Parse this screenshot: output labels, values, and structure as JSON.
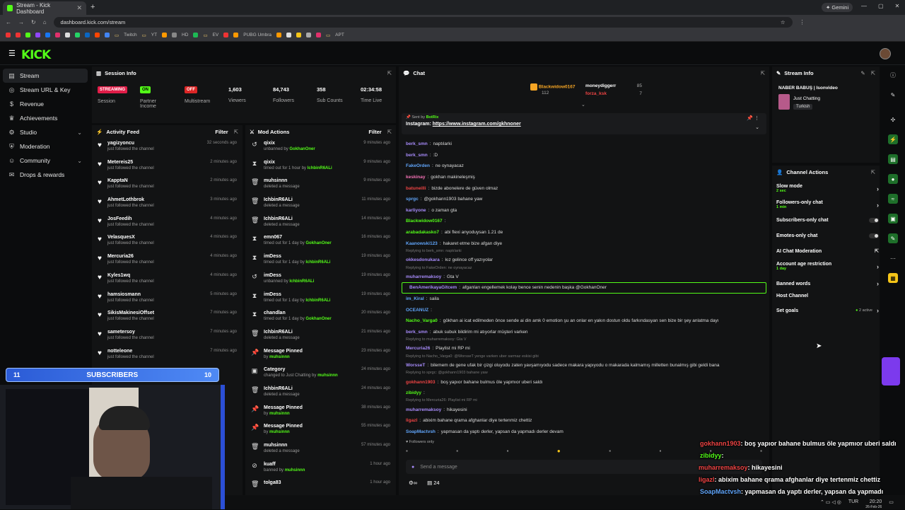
{
  "browser": {
    "tab_title": "Stream - Kick Dashboard",
    "url": "dashboard.kick.com/stream",
    "gemini_label": "Gemini",
    "bookmarks": [
      "Twitch",
      "YT",
      "HD",
      "EV",
      "PUBG Umbra",
      "APT"
    ]
  },
  "brand": {
    "logo": "KICK",
    "accent": "#53fc18"
  },
  "sidebar": {
    "items": [
      {
        "label": "Stream",
        "icon": "stream-icon"
      },
      {
        "label": "Stream URL & Key",
        "icon": "globe-icon"
      },
      {
        "label": "Revenue",
        "icon": "dollar-icon"
      },
      {
        "label": "Achievements",
        "icon": "trophy-icon"
      },
      {
        "label": "Studio",
        "icon": "studio-icon"
      },
      {
        "label": "Moderation",
        "icon": "shield-icon"
      },
      {
        "label": "Community",
        "icon": "community-icon"
      },
      {
        "label": "Drops & rewards",
        "icon": "gift-icon"
      }
    ]
  },
  "session": {
    "title": "Session Info",
    "status_badge": "STREAMING",
    "session_label": "Session",
    "partner_badge": "ON",
    "partner_label": "Partner Income",
    "multistream_badge": "OFF",
    "multistream_label": "Multistream",
    "viewers": "1,603",
    "viewers_label": "Viewers",
    "followers": "84,743",
    "followers_label": "Followers",
    "subs": "358",
    "subs_label": "Sub Counts",
    "time": "02:34:58",
    "time_label": "Time Live"
  },
  "activity": {
    "title": "Activity Feed",
    "filter": "Filter",
    "rows": [
      {
        "name": "yagizyoncu",
        "sub": "just followed the channel",
        "time": "32 seconds ago"
      },
      {
        "name": "Metereis25",
        "sub": "just followed the channel",
        "time": "2 minutes ago"
      },
      {
        "name": "KapptaN",
        "sub": "just followed the channel",
        "time": "2 minutes ago"
      },
      {
        "name": "AhmetLothbrok",
        "sub": "just followed the channel",
        "time": "3 minutes ago"
      },
      {
        "name": "JosFeedih",
        "sub": "just followed the channel",
        "time": "4 minutes ago"
      },
      {
        "name": "VelasquesX",
        "sub": "just followed the channel",
        "time": "4 minutes ago"
      },
      {
        "name": "Mercuria26",
        "sub": "just followed the channel",
        "time": "4 minutes ago"
      },
      {
        "name": "Kyles1wq",
        "sub": "just followed the channel",
        "time": "4 minutes ago"
      },
      {
        "name": "hamsiosmann",
        "sub": "just followed the channel",
        "time": "5 minutes ago"
      },
      {
        "name": "SikisMakinesiOffset",
        "sub": "just followed the channel",
        "time": "7 minutes ago"
      },
      {
        "name": "sametersoy",
        "sub": "just followed the channel",
        "time": "7 minutes ago"
      },
      {
        "name": "notteleone",
        "sub": "just followed the channel",
        "time": "7 minutes ago"
      }
    ]
  },
  "modactions": {
    "title": "Mod Actions",
    "filter": "Filter",
    "rows": [
      {
        "icon": "↺",
        "name": "qixix",
        "pre": "unbanned by ",
        "by": "GokhanOner",
        "time": "9 minutes ago"
      },
      {
        "icon": "⧗",
        "name": "qixix",
        "pre": "timed out for 1 hour by ",
        "by": "IchbinR6ALi",
        "time": "9 minutes ago"
      },
      {
        "icon": "🗑",
        "name": "muhsinnn",
        "pre": "deleted a message",
        "by": "",
        "time": "9 minutes ago"
      },
      {
        "icon": "🗑",
        "name": "IchbinR6ALi",
        "pre": "deleted a message",
        "by": "",
        "time": "11 minutes ago"
      },
      {
        "icon": "🗑",
        "name": "IchbinR6ALi",
        "pre": "deleted a message",
        "by": "",
        "time": "14 minutes ago"
      },
      {
        "icon": "⧗",
        "name": "emn067",
        "pre": "timed out for 1 day by ",
        "by": "GokhanOner",
        "time": "16 minutes ago"
      },
      {
        "icon": "⧗",
        "name": "imDess",
        "pre": "timed out for 1 day by ",
        "by": "IchbinR6ALi",
        "time": "19 minutes ago"
      },
      {
        "icon": "↺",
        "name": "imDess",
        "pre": "unbanned by ",
        "by": "IchbinR6ALi",
        "time": "19 minutes ago"
      },
      {
        "icon": "⧗",
        "name": "imDess",
        "pre": "timed out for 1 day by ",
        "by": "IchbinR6ALi",
        "time": "19 minutes ago"
      },
      {
        "icon": "⧗",
        "name": "chandlan",
        "pre": "timed out for 1 day by ",
        "by": "GokhanOner",
        "time": "20 minutes ago"
      },
      {
        "icon": "🗑",
        "name": "IchbinR6ALi",
        "pre": "deleted a message",
        "by": "",
        "time": "21 minutes ago"
      },
      {
        "icon": "📌",
        "name": "Message Pinned",
        "pre": "by ",
        "by": "muhsinnn",
        "time": "23 minutes ago"
      },
      {
        "icon": "▣",
        "name": "Category",
        "pre": "changed to Just Chatting by ",
        "by": "muhsinnn",
        "time": "24 minutes ago"
      },
      {
        "icon": "🗑",
        "name": "IchbinR6ALi",
        "pre": "deleted a message",
        "by": "",
        "time": "24 minutes ago"
      },
      {
        "icon": "📌",
        "name": "Message Pinned",
        "pre": "by ",
        "by": "muhsinnn",
        "time": "38 minutes ago"
      },
      {
        "icon": "📌",
        "name": "Message Pinned",
        "pre": "by ",
        "by": "muhsinnn",
        "time": "55 minutes ago"
      },
      {
        "icon": "🗑",
        "name": "muhsinnn",
        "pre": "deleted a message",
        "by": "",
        "time": "57 minutes ago"
      },
      {
        "icon": "⊘",
        "name": "kuaff",
        "pre": "banned by ",
        "by": "muhsinnn",
        "time": "1 hour ago"
      },
      {
        "icon": "🗑",
        "name": "tolga83",
        "pre": "",
        "by": "",
        "time": "1 hour ago"
      }
    ]
  },
  "chat": {
    "title": "Chat",
    "top_gifters": [
      {
        "name": "Blackwidow0167",
        "count": "112"
      },
      {
        "name": "moneydiggerr",
        "count": "85"
      },
      {
        "name": "forza_ksk",
        "count": "7"
      }
    ],
    "pinned": {
      "sent_by": "Sent by",
      "bot": "BotRix",
      "text": "Instagram: ",
      "link": "https://www.instagram.com/gkhnoner"
    },
    "messages": [
      {
        "user": "berk_smn",
        "color": "#a78bfa",
        "text": "naptılarki",
        "reply": ""
      },
      {
        "user": "berk_smn",
        "color": "#a78bfa",
        "text": ":D",
        "reply": ""
      },
      {
        "user": "FakeOrden",
        "color": "#60a5fa",
        "text": "ne oynayacaz",
        "reply": ""
      },
      {
        "user": "keskinay",
        "color": "#f472b6",
        "text": "gokhan makineleşmiş",
        "reply": ""
      },
      {
        "user": "batuneilli",
        "color": "#ef4444",
        "text": "bizde abonelere de güven olmaz",
        "reply": ""
      },
      {
        "user": "sprgc",
        "color": "#60a5fa",
        "text": "@gokhann1903 bahane yaw",
        "reply": ""
      },
      {
        "user": "karliyone",
        "color": "#a78bfa",
        "text": "o zaman gta",
        "reply": ""
      },
      {
        "user": "Blackwidow0167",
        "color": "#53fc18",
        "text": "",
        "reply": ""
      },
      {
        "user": "arabadakasko7",
        "color": "#53fc18",
        "text": "abi flexi anyoduysan 1.21 de",
        "reply": ""
      },
      {
        "user": "Kaanowski123",
        "color": "#60a5fa",
        "text": "hakaret etme bize afgan diye",
        "reply": ""
      },
      {
        "user": "okkesdonukara",
        "color": "#a78bfa",
        "text": "kız gelince off yazıyolar",
        "reply": "Replying to berk_smn: naptılarki"
      },
      {
        "user": "muharremaksoy",
        "color": "#a78bfa",
        "text": "Gta V",
        "reply": "Replying to FakeOrden: ne oynayacaz"
      },
      {
        "user": "BenAmerikayaGitcem",
        "color": "#a78bfa",
        "text": "afganları engellemek kolay bence senin nedenin başka @GokhanOner",
        "reply": "",
        "highlight": "true"
      },
      {
        "user": "im_Kiral",
        "color": "#60a5fa",
        "text": "saila",
        "reply": ""
      },
      {
        "user": "OCEANUZ",
        "color": "#60a5fa",
        "text": "",
        "reply": ""
      },
      {
        "user": "Nacho_Varga0",
        "color": "#53fc18",
        "text": "gökhan ai icat edilmeden önce sende ai din amk 0 emotion şu an onlar en yakın dostun oldu farkındasyan sen bize bir şey anlatma dayı",
        "reply": ""
      },
      {
        "user": "berk_smn",
        "color": "#a78bfa",
        "text": "abuk subuk bildirim mi atıyorlar müşteri varken",
        "reply": ""
      },
      {
        "user": "Mercuria26",
        "color": "#a78bfa",
        "text": "Playlist mi RP mi",
        "reply": "Replying to muharremaksoy: Gta V"
      },
      {
        "user": "WorsseT",
        "color": "#a78bfa",
        "text": "bilemem de gene ufak bir çizgi oluyodu zaten yavşamıyodu sadece makara yapıyodu o makarada kalmamış milletten bunalmış gibi geldi bana",
        "reply": "Replying to Nacho_Varga0: @WorsseT yenge varken uber sarmaz eskisi gibi"
      },
      {
        "user": "gokhann1903",
        "color": "#ef4444",
        "text": "boş yapıor bahane bulmus öle yapmıor uberi saldı",
        "reply": "Replying to sprgc: @gokhann1903 bahane yaw"
      },
      {
        "user": "zibidyy",
        "color": "#53fc18",
        "text": "",
        "reply": ""
      },
      {
        "user": "muharremaksoy",
        "color": "#a78bfa",
        "text": "hikayesini",
        "reply": "Replying to Mercuria26: Playlist mi RP mi"
      },
      {
        "user": "ligazl",
        "color": "#ef4444",
        "text": "abixim bahane qrama afghanlar diye tertenmiz chettiz",
        "reply": ""
      },
      {
        "user": "SoapMactvsh",
        "color": "#60a5fa",
        "text": "yapmasan da yaptı derler, yapsan da yapmadı derler devam",
        "reply": ""
      }
    ],
    "followers_only": "Followers only",
    "placeholder": "Send a message",
    "viewer_count": "24"
  },
  "stream_info": {
    "title": "Stream Info",
    "stream_title": "NABER BABUŞ | Isonvideo",
    "category": "Just Chatting",
    "language": "Turkish"
  },
  "channel_actions": {
    "title": "Channel Actions",
    "rows": [
      {
        "label": "Slow mode",
        "sub": "2 sec",
        "control": "arrow"
      },
      {
        "label": "Followers-only chat",
        "sub": "1 min",
        "control": "arrow"
      },
      {
        "label": "Subscribers-only chat",
        "sub": "",
        "control": "toggle"
      },
      {
        "label": "Emotes-only chat",
        "sub": "",
        "control": "toggle"
      },
      {
        "label": "AI Chat Moderation",
        "sub": "",
        "control": "external"
      },
      {
        "label": "Account age restriction",
        "sub": "1 day",
        "control": "arrow"
      },
      {
        "label": "Banned words",
        "sub": "",
        "control": "arrow"
      },
      {
        "label": "Host Channel",
        "sub": "",
        "control": "none"
      },
      {
        "label": "Set goals",
        "sub": "",
        "control": "arrow",
        "extra": "2 active"
      }
    ]
  },
  "overlay": {
    "subscribers_label": "SUBSCRIBERS",
    "left_count": "11",
    "right_count": "10",
    "messages": [
      {
        "user": "gokhann1903",
        "text": ": boş yapıor bahane bulmus öle yapmıor uberi saldı"
      },
      {
        "user": "zibidyy",
        "text": ":"
      },
      {
        "user": "muharremaksoy",
        "text": ": hikayesini"
      },
      {
        "user": "ligazl",
        "text": ": abixim bahane qrama afghanlar diye tertenmiz chettiz"
      },
      {
        "user": "SoapMactvsh",
        "text": ": yapmasan da yaptı derler, yapsan da yapmadı"
      },
      {
        "user": "",
        "text": "derler devam"
      }
    ]
  },
  "taskbar": {
    "lang": "TUR",
    "time": "20:20",
    "date": "26-Feb-26"
  }
}
